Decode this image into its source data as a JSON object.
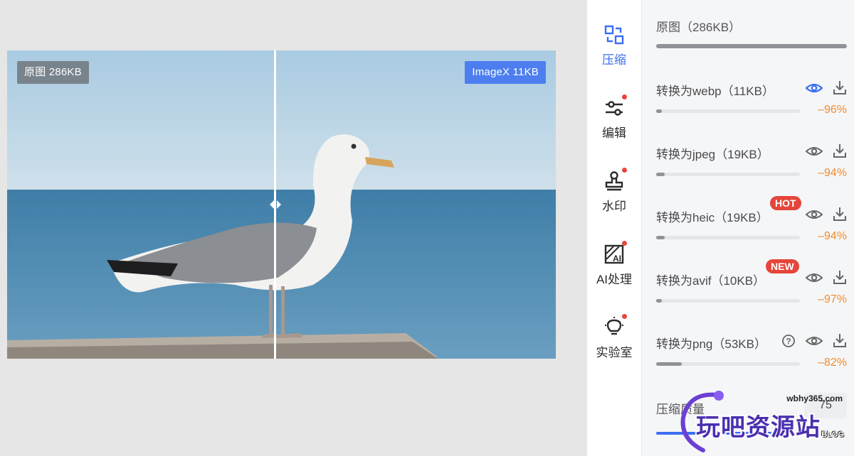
{
  "compare": {
    "left_tag": "原图 286KB",
    "right_tag": "ImageX 11KB"
  },
  "nav": {
    "items": [
      {
        "label": "压缩",
        "icon": "compress-icon",
        "active": true,
        "dot": false
      },
      {
        "label": "编辑",
        "icon": "sliders-icon",
        "active": false,
        "dot": true
      },
      {
        "label": "水印",
        "icon": "stamp-icon",
        "active": false,
        "dot": true
      },
      {
        "label": "AI处理",
        "icon": "ai-icon",
        "active": false,
        "dot": true
      },
      {
        "label": "实验室",
        "icon": "bulb-icon",
        "active": false,
        "dot": true
      }
    ]
  },
  "panel": {
    "original_label": "原图（286KB）",
    "conversions": [
      {
        "title": "转换为webp（11KB）",
        "percent": "–96%",
        "ratio": 0.04,
        "eye_active": true,
        "badge": ""
      },
      {
        "title": "转换为jpeg（19KB）",
        "percent": "–94%",
        "ratio": 0.06,
        "eye_active": false,
        "badge": ""
      },
      {
        "title": "转换为heic（19KB）",
        "percent": "–94%",
        "ratio": 0.06,
        "eye_active": false,
        "badge": "HOT"
      },
      {
        "title": "转换为avif（10KB）",
        "percent": "–97%",
        "ratio": 0.03,
        "eye_active": false,
        "badge": "NEW"
      },
      {
        "title": "转换为png（53KB）",
        "percent": "–82%",
        "ratio": 0.18,
        "eye_active": false,
        "badge": "",
        "help": true
      }
    ],
    "quality_label": "压缩质量",
    "quality_value": "75"
  },
  "watermark": {
    "url": "wbhy365.com",
    "text": "玩吧资源站",
    "blog": "BLOG"
  },
  "colors": {
    "accent": "#3b6ef2",
    "percent": "#f08c2a",
    "badge": "#e5453a",
    "imagex_tag": "#4d7ef0"
  }
}
